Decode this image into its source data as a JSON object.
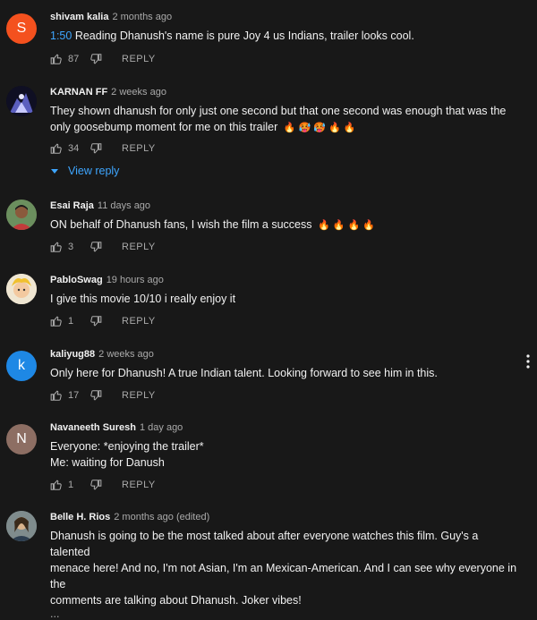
{
  "comments": [
    {
      "author": "shivam kalia",
      "date": "2 months ago",
      "timestamp_link": "1:50",
      "text": " Reading Dhanush's name is pure Joy 4 us Indians, trailer looks cool.",
      "likes": "87",
      "reply_label": "REPLY",
      "avatar_letter": "S",
      "avatar_color": "#f4511e"
    },
    {
      "author": "KARNAN FF",
      "date": "2 weeks ago",
      "text_line1": "They shown dhanush for only just one second but that one second was enough  that was the",
      "text_line2": "only goosebump moment for me on this trailer",
      "emojis": "🔥 🥵 🥵 🔥 🔥",
      "likes": "34",
      "reply_label": "REPLY",
      "view_reply": "View reply"
    },
    {
      "author": "Esai Raja",
      "date": "11 days ago",
      "text": "ON behalf of Dhanush fans, I wish the film a success",
      "emojis": "🔥 🔥 🔥 🔥",
      "likes": "3",
      "reply_label": "REPLY"
    },
    {
      "author": "PabloSwag",
      "date": "19 hours ago",
      "text": "I give this movie 10/10 i really enjoy it",
      "likes": "1",
      "reply_label": "REPLY"
    },
    {
      "author": "kaliyug88",
      "date": "2 weeks ago",
      "text": "Only here for Dhanush! A true Indian talent. Looking forward to see him in this.",
      "likes": "17",
      "reply_label": "REPLY",
      "avatar_letter": "k",
      "avatar_color": "#1e88e5"
    },
    {
      "author": "Navaneeth Suresh",
      "date": "1 day ago",
      "text_line1": "Everyone: *enjoying the trailer*",
      "text_line2": "Me: waiting for Danush",
      "likes": "1",
      "reply_label": "REPLY",
      "avatar_letter": "N",
      "avatar_color": "#8d6e63"
    },
    {
      "author": "Belle H. Rios",
      "date": "2 months ago (edited)",
      "text_line1": "Dhanush is going to be the most talked about after everyone watches this film. Guy's a talented",
      "text_line2": "menace here! And no, I'm not Asian, I'm an Mexican-American. And I can see why everyone in the",
      "text_line3": "comments are talking about Dhanush. Joker vibes!",
      "truncation": "..."
    }
  ],
  "icons": {
    "like": "thumbs-up-icon",
    "dislike": "thumbs-down-icon",
    "expand": "triangle-down-icon",
    "more": "more-vert-icon"
  },
  "colors": {
    "background": "#181818",
    "link_blue": "#3ea6ff",
    "secondary_text": "#aaaaaa"
  }
}
